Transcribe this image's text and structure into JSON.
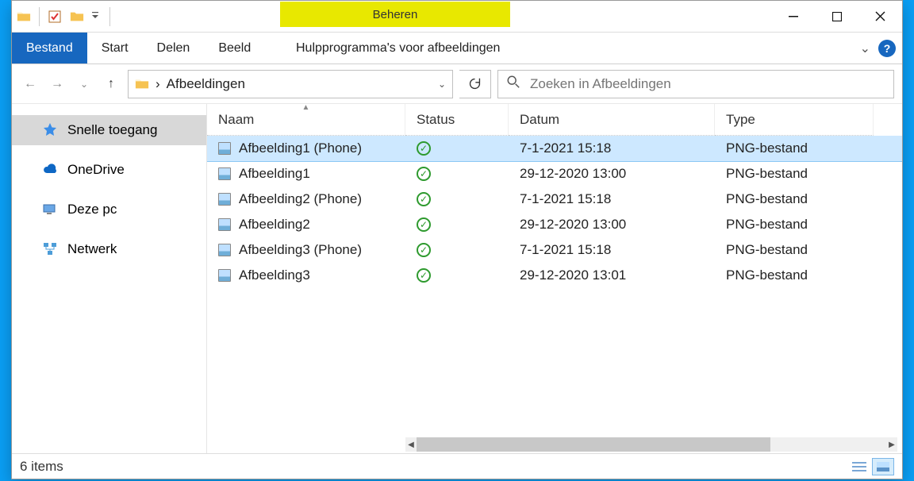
{
  "window": {
    "title": "Afbeeldingen"
  },
  "titlebar": {
    "contextual_label": "Beheren"
  },
  "ribbon": {
    "file": "Bestand",
    "tabs": [
      "Start",
      "Delen",
      "Beeld"
    ],
    "contextual_tab": "Hulpprogramma's voor afbeeldingen"
  },
  "address": {
    "crumb_sep": "›",
    "folder": "Afbeeldingen"
  },
  "search": {
    "placeholder": "Zoeken in Afbeeldingen"
  },
  "nav": {
    "items": [
      {
        "label": "Snelle toegang",
        "icon": "star"
      },
      {
        "label": "OneDrive",
        "icon": "cloud"
      },
      {
        "label": "Deze pc",
        "icon": "pc"
      },
      {
        "label": "Netwerk",
        "icon": "network"
      }
    ]
  },
  "columns": [
    "Naam",
    "Status",
    "Datum",
    "Type"
  ],
  "rows": [
    {
      "name": "Afbeelding1 (Phone)",
      "date": "7-1-2021 15:18",
      "type": "PNG-bestand",
      "selected": true
    },
    {
      "name": "Afbeelding1",
      "date": "29-12-2020 13:00",
      "type": "PNG-bestand",
      "selected": false
    },
    {
      "name": "Afbeelding2 (Phone)",
      "date": "7-1-2021 15:18",
      "type": "PNG-bestand",
      "selected": false
    },
    {
      "name": "Afbeelding2",
      "date": "29-12-2020 13:00",
      "type": "PNG-bestand",
      "selected": false
    },
    {
      "name": "Afbeelding3 (Phone)",
      "date": "7-1-2021 15:18",
      "type": "PNG-bestand",
      "selected": false
    },
    {
      "name": "Afbeelding3",
      "date": "29-12-2020 13:01",
      "type": "PNG-bestand",
      "selected": false
    }
  ],
  "status": {
    "text": "6 items"
  }
}
